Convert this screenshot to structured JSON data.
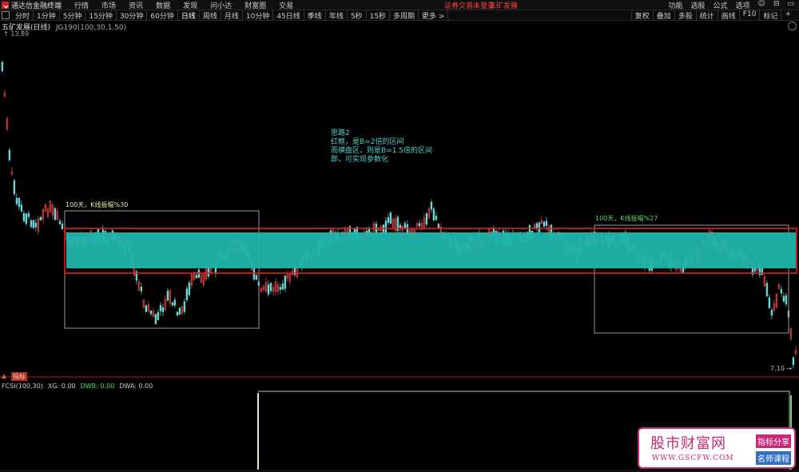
{
  "app": {
    "title": "通达信金融终端",
    "menu": [
      "行情",
      "市场",
      "资讯",
      "数据",
      "发现",
      "问小达",
      "财富圈",
      "交易"
    ],
    "notice": "证券交易未登录",
    "notice_right": "五矿发展",
    "right_menu": [
      "功能",
      "选股",
      "公式",
      "选项",
      "☺",
      "⊟",
      "▭"
    ]
  },
  "toolbar": {
    "periods": [
      "分时",
      "1分钟",
      "5分钟",
      "15分钟",
      "30分钟",
      "60分钟",
      "日线",
      "周线",
      "月线",
      "10分钟",
      "45日线",
      "季线",
      "年线",
      "5秒",
      "15秒",
      "多周期",
      "更多 >"
    ],
    "active": "日线",
    "right": [
      "复权",
      "叠加",
      "多股",
      "统计",
      "画线",
      "F10",
      "标记",
      "+"
    ]
  },
  "chart": {
    "title": "五矿发展(日线)",
    "indicator": "JG190(100,30,1.50)",
    "price_high": "13.89",
    "price_low": "7.10",
    "note_lines": [
      "思路2",
      "红框，是B=2倍的区间",
      "而横盘区，则是B=1.5倍的区间",
      "即，可实现参数化"
    ],
    "box1_label": "100天，K线振幅%30",
    "box2_label": "100天，K线振幅%27",
    "colors": {
      "band": "#20b4aa",
      "redframe": "#e02020",
      "up": "#e04646",
      "down": "#6ad6d6",
      "box": "#9a9a9a"
    }
  },
  "subpanel": {
    "tab_label": "指标",
    "indicator": "FCSI(100,30)",
    "xg": "XG: 0.00",
    "dwb": "DWB: 0.00",
    "dwa": "DWA: 0.00"
  },
  "watermark": {
    "big": "股市财富网",
    "url": "WWW.GSCFW.COM",
    "tag1": "指标分享",
    "tag2": "名师课程"
  }
}
